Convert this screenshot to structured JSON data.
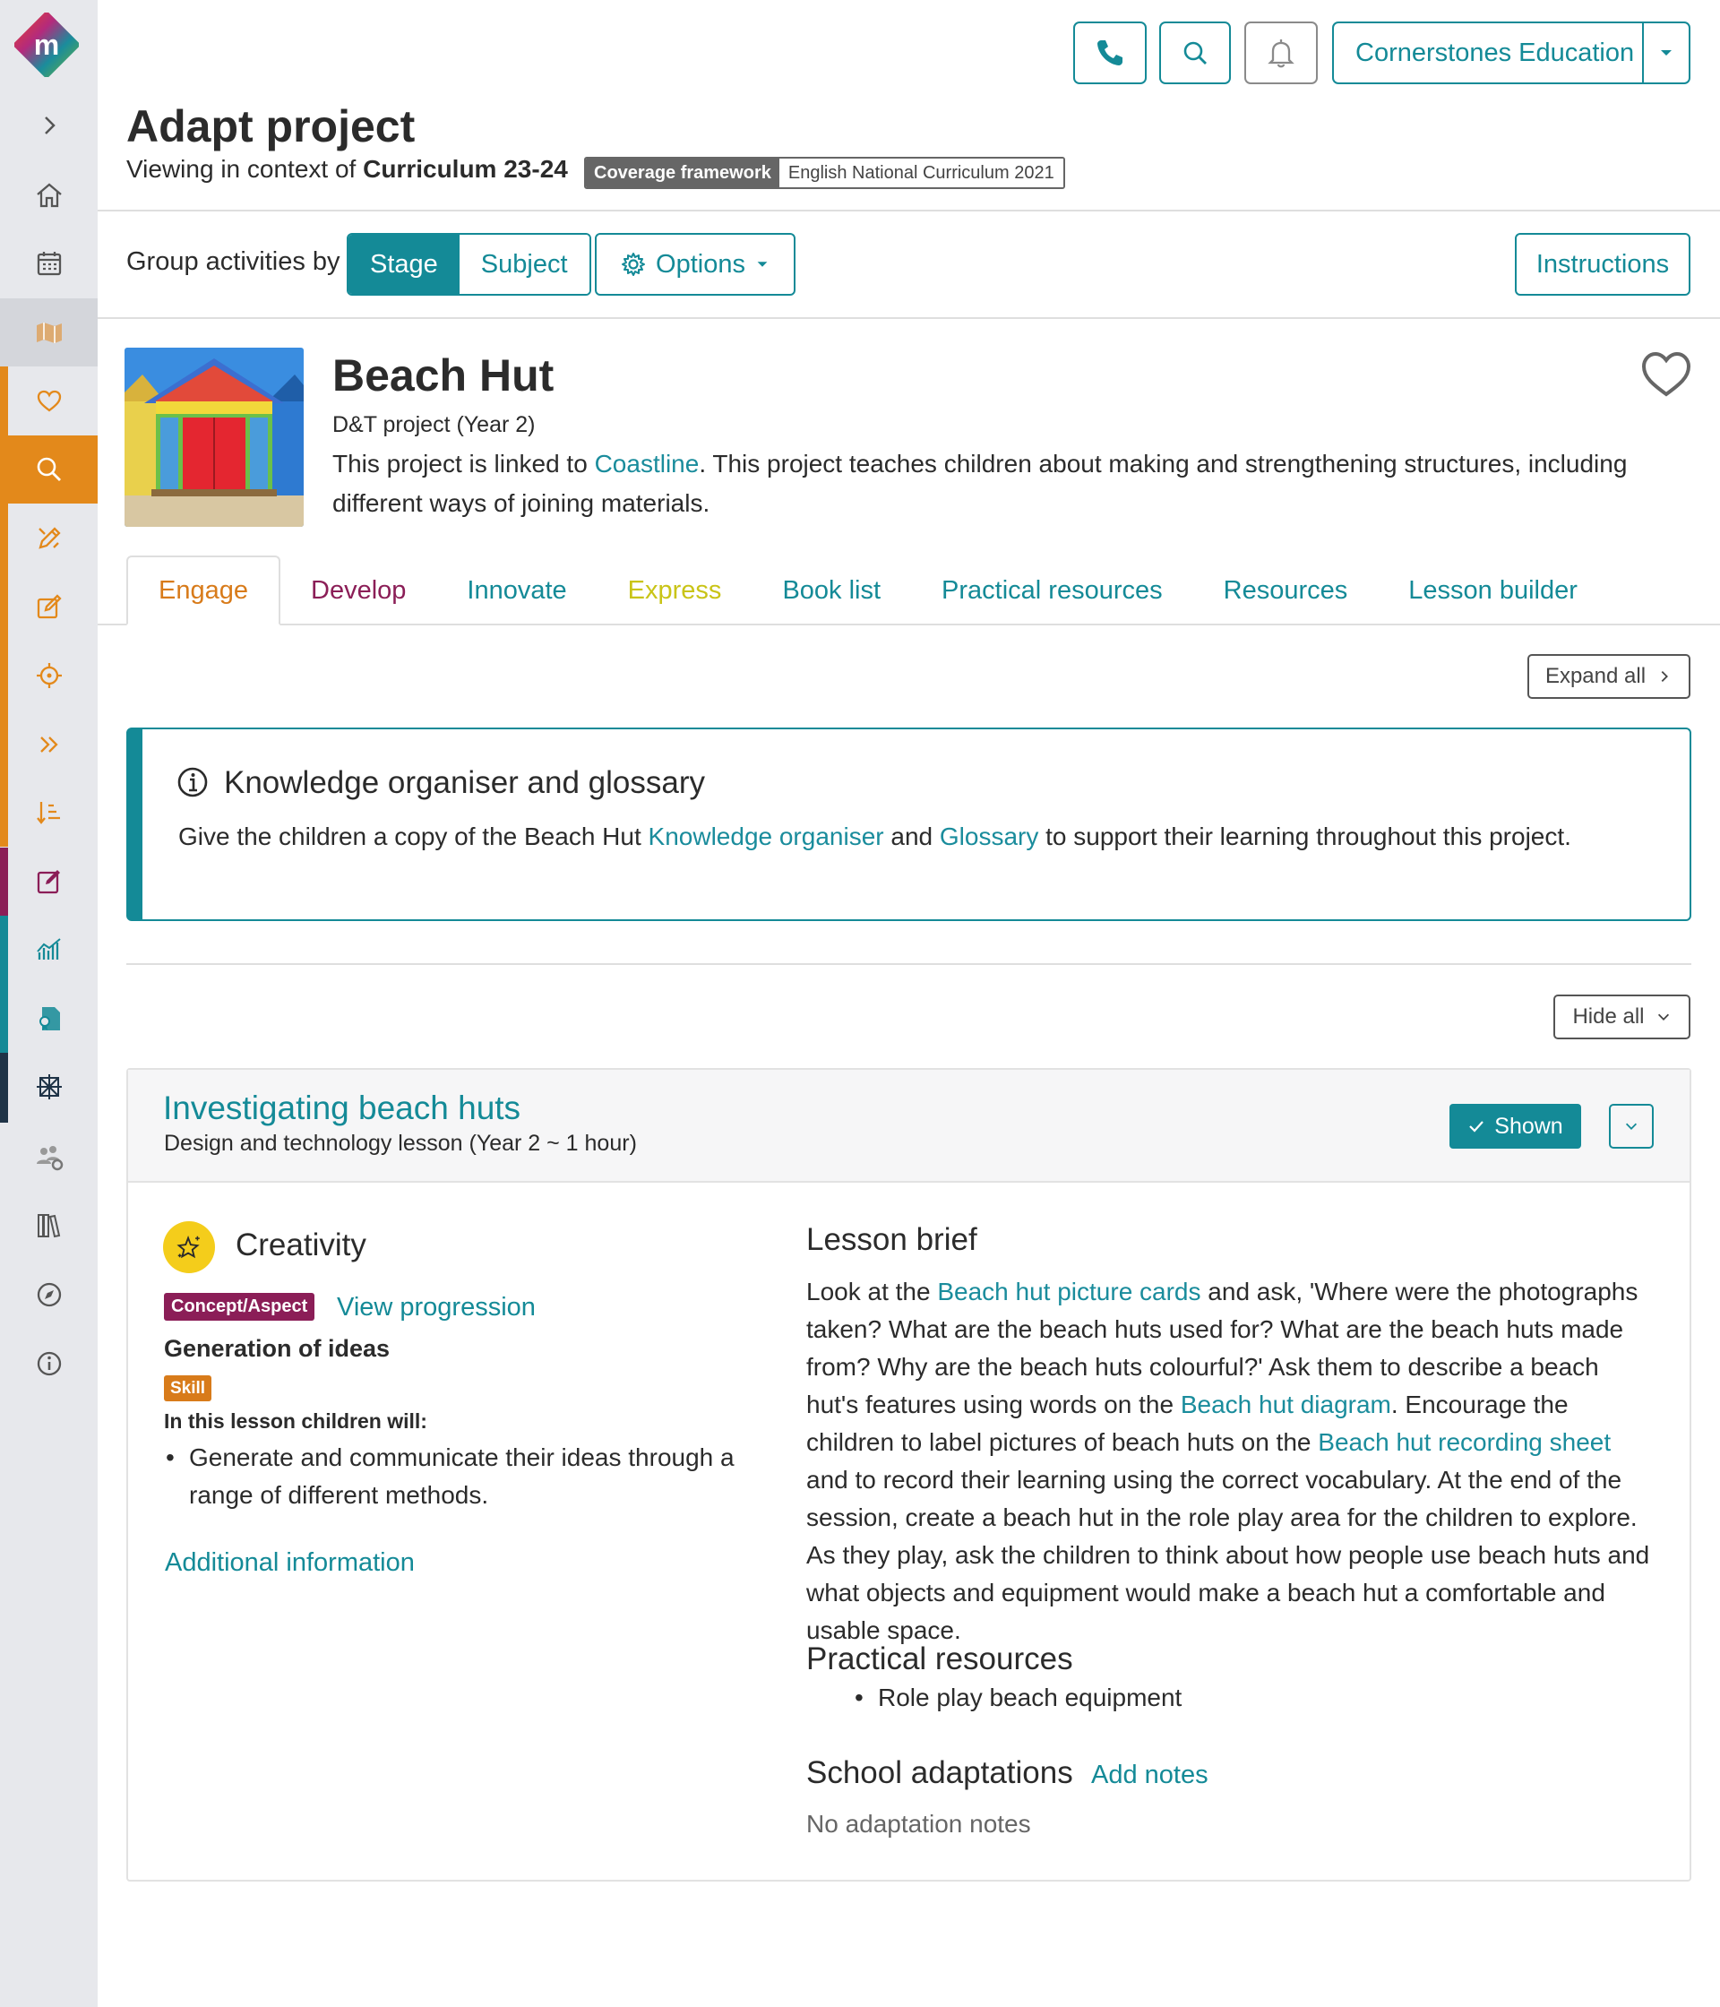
{
  "topbar": {
    "organisation": "Cornerstones Education"
  },
  "header": {
    "title": "Adapt project",
    "context_prefix": "Viewing in context of",
    "context_value": "Curriculum 23-24",
    "coverage_key": "Coverage framework",
    "coverage_value": "English National Curriculum 2021"
  },
  "toolbar": {
    "group_label": "Group activities by",
    "group_options": [
      "Stage",
      "Subject"
    ],
    "group_selected": "Stage",
    "options_label": "Options",
    "instructions_label": "Instructions"
  },
  "project": {
    "title": "Beach Hut",
    "subtitle": "D&T project (Year 2)",
    "desc_prefix": "This project is linked to",
    "desc_link": "Coastline",
    "desc_suffix": ". This project teaches children about making and strengthening structures, including different ways of joining materials."
  },
  "tabs": [
    {
      "label": "Engage",
      "color": "#d87b1a",
      "active": true
    },
    {
      "label": "Develop",
      "color": "#8b1e57",
      "active": false
    },
    {
      "label": "Innovate",
      "color": "#148a97",
      "active": false
    },
    {
      "label": "Express",
      "color": "#c9c417",
      "active": false
    },
    {
      "label": "Book list",
      "color": "#148a97",
      "active": false
    },
    {
      "label": "Practical resources",
      "color": "#148a97",
      "active": false
    },
    {
      "label": "Resources",
      "color": "#148a97",
      "active": false
    },
    {
      "label": "Lesson builder",
      "color": "#148a97",
      "active": false
    }
  ],
  "controls": {
    "expand_all": "Expand all",
    "hide_all": "Hide all"
  },
  "knowledge": {
    "title": "Knowledge organiser and glossary",
    "text_1": "Give the children a copy of the Beach Hut",
    "link_1": "Knowledge organiser",
    "text_2": "and",
    "link_2": "Glossary",
    "text_3": "to support their learning throughout this project."
  },
  "lesson": {
    "title": "Investigating beach huts",
    "subtitle": "Design and technology lesson (Year 2 ~ 1 hour)",
    "shown_label": "Shown",
    "aspect": "Creativity",
    "concept_badge": "Concept/Aspect",
    "view_progression": "View progression",
    "concept_name": "Generation of ideas",
    "skill_badge": "Skill",
    "will_label": "In this lesson children will:",
    "will_items": [
      "Generate and communicate their ideas through a range of different methods."
    ],
    "additional_info": "Additional information",
    "brief_title": "Lesson brief",
    "brief": {
      "t1": "Look at the",
      "l1": "Beach hut picture cards",
      "t2": "and ask, 'Where were the photographs taken? What are the beach huts used for? What are the beach huts made from? Why are the beach huts colourful?' Ask them to describe a beach hut's features using words on the",
      "l2": "Beach hut diagram",
      "t3": ". Encourage the children to label pictures of beach huts on the",
      "l3": "Beach hut recording sheet",
      "t4": "and to record their learning using the correct vocabulary. At the end of the session, create a beach hut in the role play area for the children to explore. As they play, ask the children to think about how people use beach huts and what objects and equipment would make a beach hut a comfortable and usable space."
    },
    "practical_title": "Practical resources",
    "practical_items": [
      "Role play beach equipment"
    ],
    "adapt_title": "School adaptations",
    "add_notes": "Add notes",
    "no_notes": "No adaptation notes"
  }
}
